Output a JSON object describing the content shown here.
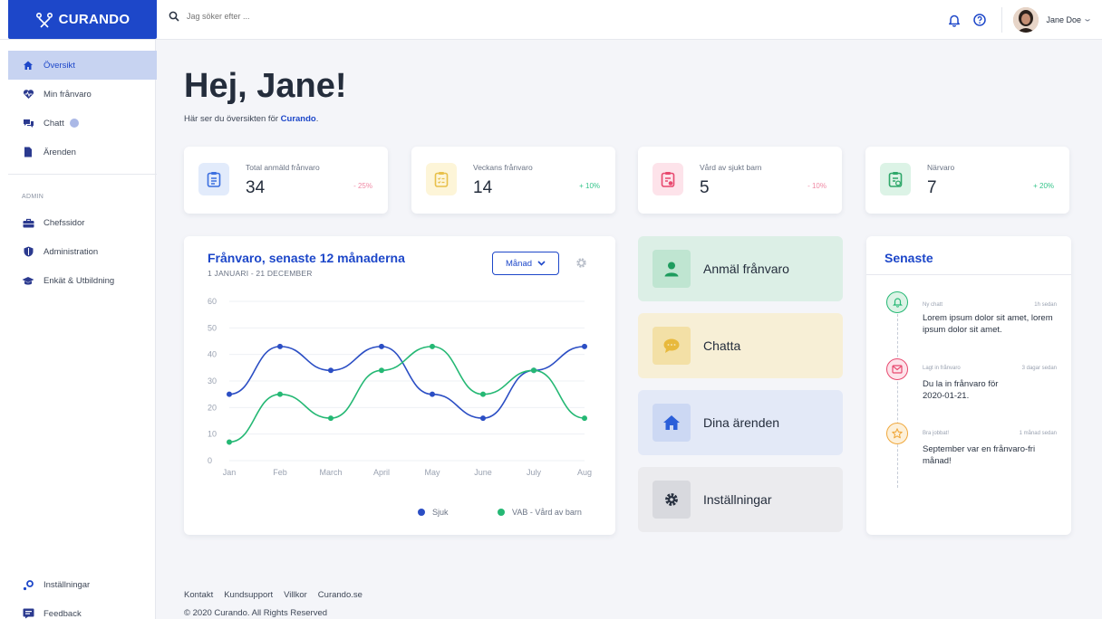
{
  "brand": {
    "name": "CURANDO"
  },
  "search": {
    "placeholder": "Jag söker efter ..."
  },
  "user": {
    "name": "Jane Doe"
  },
  "sidebar": {
    "items": [
      {
        "label": "Översikt",
        "icon": "home-icon"
      },
      {
        "label": "Min frånvaro",
        "icon": "heart-icon"
      },
      {
        "label": "Chatt",
        "icon": "chat-icon"
      },
      {
        "label": "Ärenden",
        "icon": "document-icon"
      }
    ],
    "admin_label": "ADMIN",
    "admin_items": [
      {
        "label": "Chefssidor",
        "icon": "briefcase-icon"
      },
      {
        "label": "Administration",
        "icon": "shield-icon"
      },
      {
        "label": "Enkät & Utbildning",
        "icon": "graduation-cap-icon"
      }
    ],
    "bottom_items": [
      {
        "label": "Inställningar",
        "icon": "settings-icon"
      },
      {
        "label": "Feedback",
        "icon": "feedback-icon"
      }
    ]
  },
  "main": {
    "greeting": "Hej, Jane!",
    "subtitle_prefix": "Här ser du översikten för ",
    "subtitle_brand": "Curando",
    "subtitle_suffix": "."
  },
  "stats": [
    {
      "label": "Total anmäld frånvaro",
      "value": "34",
      "change": "- 25%",
      "color": "#3b6fe0",
      "bg": "#e2ebfb",
      "change_color": "#f08aa5"
    },
    {
      "label": "Veckans frånvaro",
      "value": "14",
      "change": "+ 10%",
      "color": "#e8c04a",
      "bg": "#fdf5d8",
      "change_color": "#37c58c"
    },
    {
      "label": "Vård av sjukt barn",
      "value": "5",
      "change": "- 10%",
      "color": "#e8496f",
      "bg": "#fde3ea",
      "change_color": "#f08aa5"
    },
    {
      "label": "Närvaro",
      "value": "7",
      "change": "+ 20%",
      "color": "#2fa86a",
      "bg": "#dcf3e6",
      "change_color": "#37c58c"
    }
  ],
  "chart_card": {
    "title": "Frånvaro, senaste 12 månaderna",
    "date_range": "1 JANUARI - 21 DECEMBER",
    "period_button": "Månad"
  },
  "chart_data": {
    "type": "line",
    "x": [
      "Jan",
      "Feb",
      "March",
      "April",
      "May",
      "June",
      "July",
      "Aug"
    ],
    "ylim": [
      0,
      60
    ],
    "yticks": [
      0,
      10,
      20,
      30,
      40,
      50,
      60
    ],
    "series": [
      {
        "name": "Sjuk",
        "values": [
          25,
          43,
          34,
          43,
          25,
          16,
          34,
          43
        ],
        "color": "#2b4ec4"
      },
      {
        "name": "VAB - Vård av barn",
        "values": [
          7,
          25,
          16,
          34,
          43,
          25,
          34,
          16
        ],
        "color": "#25b874"
      }
    ],
    "legend": "bottom-right",
    "grid": true
  },
  "actions": [
    {
      "label": "Anmäl frånvaro",
      "icon": "user-icon",
      "bg": "#dcefe6",
      "icon_bg": "#bfe5d1",
      "icon_color": "#1e9c5e"
    },
    {
      "label": "Chatta",
      "icon": "chat-bubble-icon",
      "bg": "#f7efd6",
      "icon_bg": "#f3e0a6",
      "icon_color": "#e8b93c"
    },
    {
      "label": "Dina ärenden",
      "icon": "home-icon",
      "bg": "#e3e9f7",
      "icon_bg": "#ccd8f3",
      "icon_color": "#2b5fd9"
    },
    {
      "label": "Inställningar",
      "icon": "gear-icon",
      "bg": "#ebebee",
      "icon_bg": "#d8d9de",
      "icon_color": "#2a3342"
    }
  ],
  "recent": {
    "title": "Senaste",
    "items": [
      {
        "meta": "Ny chatt",
        "time": "1h sedan",
        "text": "Lorem ipsum dolor sit amet, lorem ipsum dolor sit amet.",
        "icon": "bell-icon",
        "color": "#25b874",
        "bg": "#dcf3e6"
      },
      {
        "meta": "Lagt in frånvaro",
        "time": "3 dagar sedan",
        "text": "Du la in frånvaro för 2020-01-21.",
        "icon": "mail-icon",
        "color": "#e8496f",
        "bg": "#fde3ea"
      },
      {
        "meta": "Bra jobbat!",
        "time": "1 månad sedan",
        "text": "September var en frånvaro-fri månad!",
        "icon": "star-icon",
        "color": "#f0a83c",
        "bg": "#fdf0d9"
      }
    ]
  },
  "footer": {
    "links": [
      "Kontakt",
      "Kundsupport",
      "Villkor",
      "Curando.se"
    ],
    "copyright": "© 2020 Curando. All Rights Reserved"
  }
}
